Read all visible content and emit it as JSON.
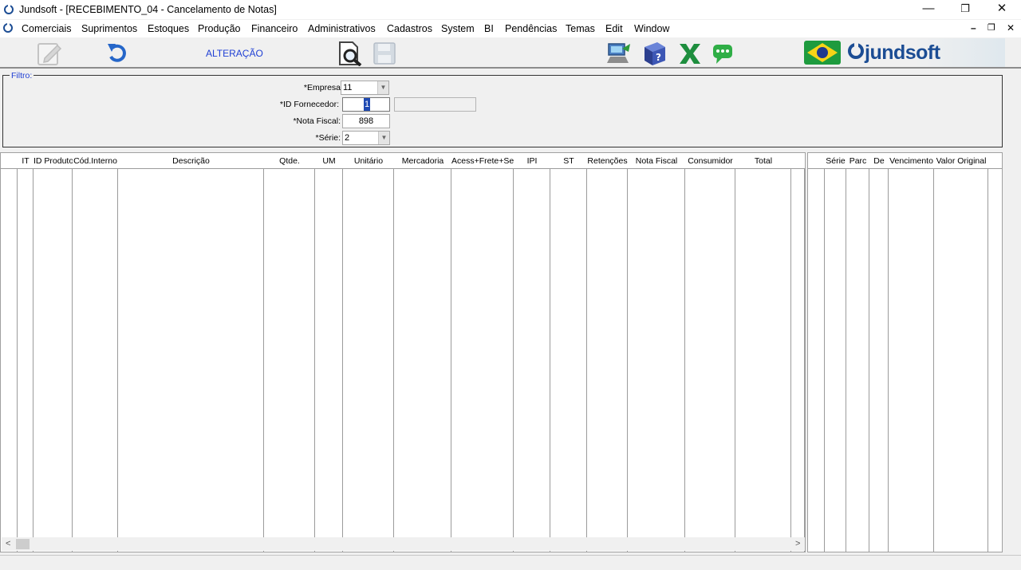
{
  "window": {
    "title": "Jundsoft - [RECEBIMENTO_04 - Cancelamento de Notas]",
    "controls": {
      "minimize": "—",
      "restore": "❐",
      "close": "✕"
    }
  },
  "menu": {
    "items": [
      "Comerciais",
      "Suprimentos",
      "Estoques",
      "Produção",
      "Financeiro",
      "Administrativos",
      "Cadastros",
      "System",
      "BI",
      "Pendências",
      "Temas",
      "Edit",
      "Window"
    ],
    "mdi_controls": {
      "minimize": "–",
      "restore": "❐",
      "close": "✕"
    }
  },
  "toolbar": {
    "mode_label": "ALTERAÇÃO",
    "brand_name": "jundsoft",
    "icons": [
      "edit-icon",
      "undo-icon",
      "search-document-icon",
      "save-icon",
      "remote-support-icon",
      "help-book-icon",
      "excel-icon",
      "chat-icon",
      "brazil-flag-icon"
    ]
  },
  "filter": {
    "legend": "Filtro:",
    "empresa_label": "*Empresa",
    "empresa_value": "11",
    "fornecedor_label": "*ID Fornecedor:",
    "fornecedor_value": "1",
    "fornecedor_name": "",
    "nota_label": "*Nota Fiscal:",
    "nota_value": "898",
    "serie_label": "*Série:",
    "serie_value": "2"
  },
  "items_grid": {
    "columns": [
      "",
      "IT",
      "ID Produto",
      "Cód.Interno",
      "Descrição",
      "Qtde.",
      "UM",
      "Unitário",
      "Mercadoria",
      "Acess+Frete+Seg",
      "IPI",
      "ST",
      "Retenções",
      "Nota Fiscal",
      "Consumidor",
      "Total",
      ""
    ],
    "scroll_left": "<",
    "scroll_right": ">"
  },
  "installments_grid": {
    "columns": [
      "",
      "Série",
      "Parc",
      "De",
      "Vencimento",
      "Valor Original",
      ""
    ]
  },
  "colors": {
    "accent": "#1f3fd4",
    "brand": "#1c4d94"
  }
}
